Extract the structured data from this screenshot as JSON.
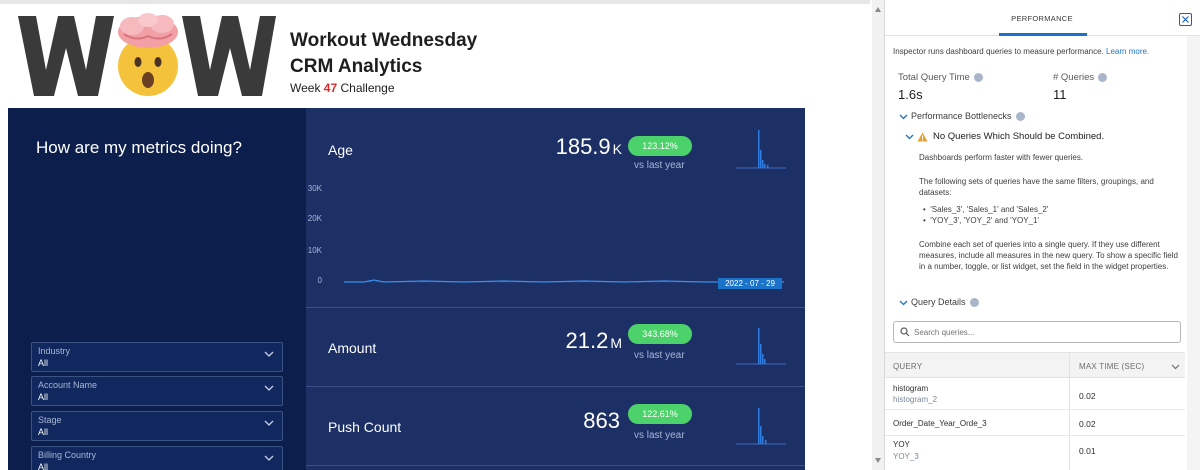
{
  "dashboard": {
    "logo_text": "WOW",
    "title_line1": "Workout Wednesday",
    "title_line2": "CRM Analytics",
    "week_prefix": "Week ",
    "week_number": "47",
    "week_suffix": " Challenge",
    "question": "How are my metrics doing?",
    "filters": [
      {
        "label": "Industry",
        "value": "All"
      },
      {
        "label": "Account Name",
        "value": "All"
      },
      {
        "label": "Stage",
        "value": "All"
      },
      {
        "label": "Billing Country",
        "value": "All"
      }
    ],
    "metrics": [
      {
        "label": "Age",
        "value": "185.9",
        "unit": "K",
        "badge": "123.12%",
        "subtext": "vs last year"
      },
      {
        "label": "Amount",
        "value": "21.2",
        "unit": "M",
        "badge": "343.68%",
        "subtext": "vs last year"
      },
      {
        "label": "Push Count",
        "value": "863",
        "unit": "",
        "badge": "122.61%",
        "subtext": "vs last year"
      }
    ],
    "chart": {
      "y_ticks": [
        "30K",
        "20K",
        "10K",
        "0"
      ],
      "date_label": "2022 - 07 - 29"
    },
    "colors": {
      "left_panel": "#0c1f4c",
      "right_panel": "#1c3065",
      "badge": "#4cd26a",
      "accent": "#1a73c9"
    }
  },
  "inspector": {
    "tab": "PERFORMANCE",
    "intro": "Inspector runs dashboard queries to measure performance.",
    "learn_more": "Learn more.",
    "total_query_label": "Total Query Time",
    "total_query_value": "1.6s",
    "num_queries_label": "# Queries",
    "num_queries_value": "11",
    "bottlenecks_title": "Performance Bottlenecks",
    "warning_title": "No Queries Which Should be Combined.",
    "para1": "Dashboards perform faster with fewer queries.",
    "para2_line1": "The following sets of queries have the same filters, groupings, and",
    "para2_line2": "datasets:",
    "bullet1": "'Sales_3', 'Sales_1' and 'Sales_2'",
    "bullet2": "'YOY_3', 'YOY_2' and 'YOY_1'",
    "para3_line1": "Combine each set of queries into a single query. If they use different",
    "para3_line2": "measures, include all measures in the new query. To show a specific field",
    "para3_line3": "in a number, toggle, or list widget, set the field in the widget properties.",
    "query_details_title": "Query Details",
    "search_placeholder": "Search queries...",
    "table_headers": {
      "query": "QUERY",
      "max_time": "MAX TIME (SEC)"
    },
    "rows": [
      {
        "name": "histogram",
        "sub": "histogram_2",
        "time": "0.02"
      },
      {
        "name": "Order_Date_Year_Orde_3",
        "sub": "",
        "time": "0.02"
      },
      {
        "name": "YOY",
        "sub": "YOY_3",
        "time": "0.01"
      }
    ]
  }
}
